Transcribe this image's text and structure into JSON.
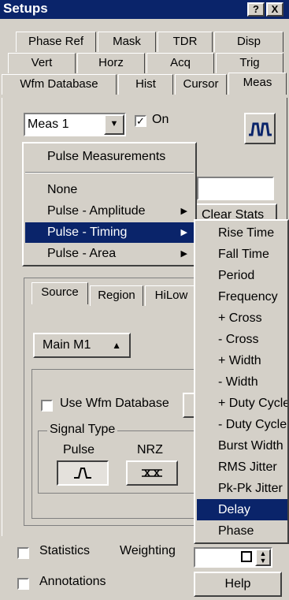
{
  "window": {
    "title": "Setups",
    "help_btn": "?",
    "close_btn": "X"
  },
  "tabs": {
    "row1": [
      "Phase Ref",
      "Mask",
      "TDR",
      "Disp"
    ],
    "row2": [
      "Vert",
      "Horz",
      "Acq",
      "Trig"
    ],
    "row3": [
      "Wfm Database",
      "Hist",
      "Cursor",
      "Meas"
    ],
    "active": "Meas"
  },
  "meas": {
    "selected": "Meas 1",
    "on_label": "On",
    "on_checked": true,
    "clear_stats": "Clear Stats"
  },
  "category_menu": {
    "header": "Pulse Measurements",
    "items": [
      "None",
      "Pulse - Amplitude",
      "Pulse - Timing",
      "Pulse - Area"
    ],
    "selected": "Pulse - Timing"
  },
  "timing_submenu": {
    "items": [
      "Rise Time",
      "Fall Time",
      "Period",
      "Frequency",
      "+ Cross",
      "- Cross",
      "+ Width",
      "- Width",
      "+ Duty Cycle",
      "- Duty Cycle",
      "Burst Width",
      "RMS Jitter",
      "Pk-Pk Jitter",
      "Delay",
      "Phase"
    ],
    "selected": "Delay"
  },
  "inner_tabs": [
    "Source",
    "Region",
    "HiLow"
  ],
  "source": {
    "main_label": "Main M1",
    "use_wfm_db": "Use Wfm Database",
    "signal_type_title": "Signal Type",
    "pulse_label": "Pulse",
    "nrz_label": "NRZ"
  },
  "bottom": {
    "statistics": "Statistics",
    "weighting": "Weighting",
    "annotations": "Annotations",
    "help": "Help"
  },
  "colors": {
    "titlebar": "#0a246a",
    "selection": "#0a246a",
    "face": "#d4d0c8"
  }
}
